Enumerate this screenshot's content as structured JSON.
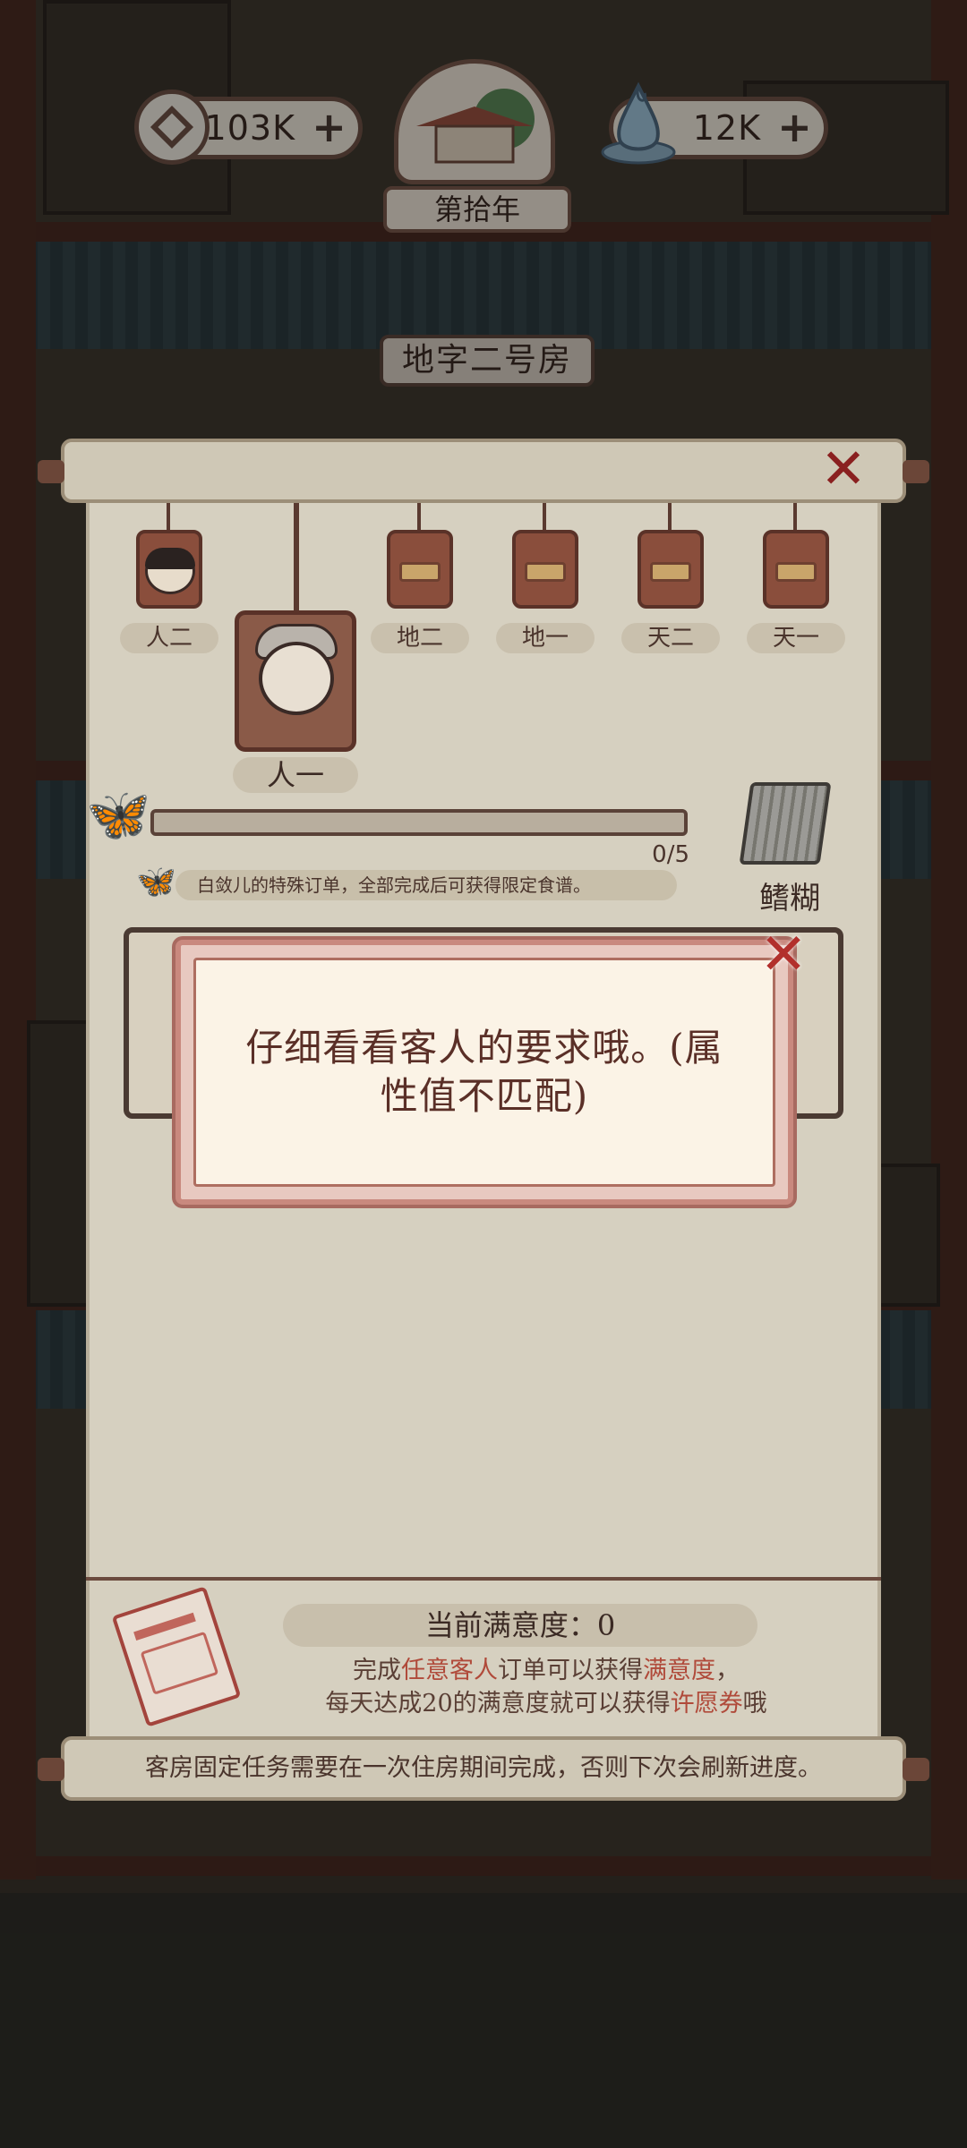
{
  "hud": {
    "coins": "103K",
    "spirit": "12K",
    "year": "第拾年",
    "room": "地字二号房"
  },
  "panel": {
    "guests": [
      {
        "label": "人二",
        "unlocked": true
      },
      {
        "label": "地二",
        "unlocked": false
      },
      {
        "label": "地一",
        "unlocked": false
      },
      {
        "label": "天二",
        "unlocked": false
      },
      {
        "label": "天一",
        "unlocked": false
      }
    ],
    "selected_guest": "人一",
    "progress": {
      "text": "0/5",
      "value": 0,
      "max": 5
    },
    "hint": "白敛儿的特殊订单，全部完成后可获得限定食谱。",
    "reward_label": "鳍糊",
    "satisfaction": {
      "title": "当前满意度：0",
      "line1_parts": [
        "完成",
        "任意客人",
        "订单可以获得",
        "满意度",
        "，"
      ],
      "line2_parts": [
        "每天达成20的满意度就可以获得",
        "许愿券",
        "哦"
      ]
    },
    "footer_note": "客房固定任务需要在一次住房期间完成，否则下次会刷新进度。"
  },
  "popup": {
    "message": "仔细看看客人的要求哦。(属性值不匹配)"
  },
  "icons": {
    "coin": "coin-icon",
    "spirit": "spirit-drop-icon",
    "close": "close-icon",
    "butterfly": "butterfly-icon",
    "ticket": "wish-ticket-icon"
  },
  "colors": {
    "accent_red": "#b04a3a",
    "close_red": "#b2302c",
    "popup_bg": "#fbf3e6"
  }
}
